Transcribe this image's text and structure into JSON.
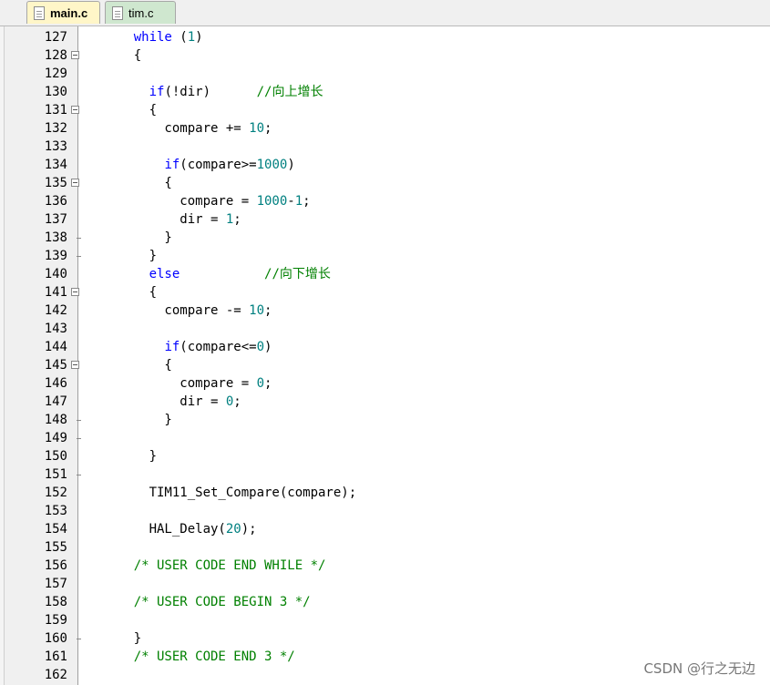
{
  "tabs": [
    {
      "label": "main.c",
      "active": true
    },
    {
      "label": "tim.c",
      "active": false
    }
  ],
  "editor": {
    "lines": [
      {
        "n": "127",
        "fold": "none",
        "tokens": [
          [
            "    ",
            ""
          ],
          [
            "while",
            "kw"
          ],
          [
            " (",
            ""
          ],
          [
            "1",
            "num"
          ],
          [
            ")",
            ""
          ]
        ]
      },
      {
        "n": "128",
        "fold": "open",
        "tokens": [
          [
            "    {",
            ""
          ]
        ]
      },
      {
        "n": "129",
        "fold": "none",
        "tokens": []
      },
      {
        "n": "130",
        "fold": "none",
        "tokens": [
          [
            "      ",
            ""
          ],
          [
            "if",
            "kw"
          ],
          [
            "(!dir)      ",
            ""
          ],
          [
            "//向上增长",
            "cm"
          ]
        ]
      },
      {
        "n": "131",
        "fold": "open",
        "tokens": [
          [
            "      {",
            ""
          ]
        ]
      },
      {
        "n": "132",
        "fold": "none",
        "tokens": [
          [
            "        compare += ",
            ""
          ],
          [
            "10",
            "num"
          ],
          [
            ";",
            ""
          ]
        ]
      },
      {
        "n": "133",
        "fold": "none",
        "tokens": []
      },
      {
        "n": "134",
        "fold": "none",
        "tokens": [
          [
            "        ",
            ""
          ],
          [
            "if",
            "kw"
          ],
          [
            "(compare>=",
            ""
          ],
          [
            "1000",
            "num"
          ],
          [
            ")",
            ""
          ]
        ]
      },
      {
        "n": "135",
        "fold": "open",
        "tokens": [
          [
            "        {",
            ""
          ]
        ]
      },
      {
        "n": "136",
        "fold": "none",
        "tokens": [
          [
            "          compare = ",
            ""
          ],
          [
            "1000",
            "num"
          ],
          [
            "-",
            ""
          ],
          [
            "1",
            "num"
          ],
          [
            ";",
            ""
          ]
        ]
      },
      {
        "n": "137",
        "fold": "none",
        "tokens": [
          [
            "          dir = ",
            ""
          ],
          [
            "1",
            "num"
          ],
          [
            ";",
            ""
          ]
        ]
      },
      {
        "n": "138",
        "fold": "end",
        "tokens": [
          [
            "        }",
            ""
          ]
        ]
      },
      {
        "n": "139",
        "fold": "end",
        "tokens": [
          [
            "      }",
            ""
          ]
        ]
      },
      {
        "n": "140",
        "fold": "none",
        "tokens": [
          [
            "      ",
            ""
          ],
          [
            "else",
            "kw"
          ],
          [
            "           ",
            ""
          ],
          [
            "//向下增长",
            "cm"
          ]
        ]
      },
      {
        "n": "141",
        "fold": "open",
        "tokens": [
          [
            "      {",
            ""
          ]
        ]
      },
      {
        "n": "142",
        "fold": "none",
        "tokens": [
          [
            "        compare -= ",
            ""
          ],
          [
            "10",
            "num"
          ],
          [
            ";",
            ""
          ]
        ]
      },
      {
        "n": "143",
        "fold": "none",
        "tokens": []
      },
      {
        "n": "144",
        "fold": "none",
        "tokens": [
          [
            "        ",
            ""
          ],
          [
            "if",
            "kw"
          ],
          [
            "(compare<=",
            ""
          ],
          [
            "0",
            "num"
          ],
          [
            ")",
            ""
          ]
        ]
      },
      {
        "n": "145",
        "fold": "open",
        "tokens": [
          [
            "        {",
            ""
          ]
        ]
      },
      {
        "n": "146",
        "fold": "none",
        "tokens": [
          [
            "          compare = ",
            ""
          ],
          [
            "0",
            "num"
          ],
          [
            ";",
            ""
          ]
        ]
      },
      {
        "n": "147",
        "fold": "none",
        "tokens": [
          [
            "          dir = ",
            ""
          ],
          [
            "0",
            "num"
          ],
          [
            ";",
            ""
          ]
        ]
      },
      {
        "n": "148",
        "fold": "end",
        "tokens": [
          [
            "        }",
            ""
          ]
        ]
      },
      {
        "n": "149",
        "fold": "end",
        "tokens": []
      },
      {
        "n": "150",
        "fold": "none",
        "tokens": [
          [
            "      }",
            ""
          ]
        ]
      },
      {
        "n": "151",
        "fold": "end",
        "tokens": []
      },
      {
        "n": "152",
        "fold": "none",
        "tokens": [
          [
            "      TIM11_Set_Compare(compare);",
            ""
          ]
        ]
      },
      {
        "n": "153",
        "fold": "none",
        "tokens": []
      },
      {
        "n": "154",
        "fold": "none",
        "tokens": [
          [
            "      HAL_Delay(",
            ""
          ],
          [
            "20",
            "num"
          ],
          [
            ");",
            ""
          ]
        ]
      },
      {
        "n": "155",
        "fold": "none",
        "tokens": []
      },
      {
        "n": "156",
        "fold": "none",
        "tokens": [
          [
            "    ",
            ""
          ],
          [
            "/* USER CODE END WHILE */",
            "cm"
          ]
        ]
      },
      {
        "n": "157",
        "fold": "none",
        "tokens": []
      },
      {
        "n": "158",
        "fold": "none",
        "tokens": [
          [
            "    ",
            ""
          ],
          [
            "/* USER CODE BEGIN 3 */",
            "cm"
          ]
        ]
      },
      {
        "n": "159",
        "fold": "none",
        "tokens": []
      },
      {
        "n": "160",
        "fold": "end",
        "tokens": [
          [
            "    }",
            ""
          ]
        ]
      },
      {
        "n": "161",
        "fold": "none",
        "tokens": [
          [
            "    ",
            ""
          ],
          [
            "/* USER CODE END 3 */",
            "cm"
          ]
        ]
      },
      {
        "n": "162",
        "fold": "none",
        "tokens": []
      }
    ]
  },
  "watermark": "CSDN @行之无边"
}
